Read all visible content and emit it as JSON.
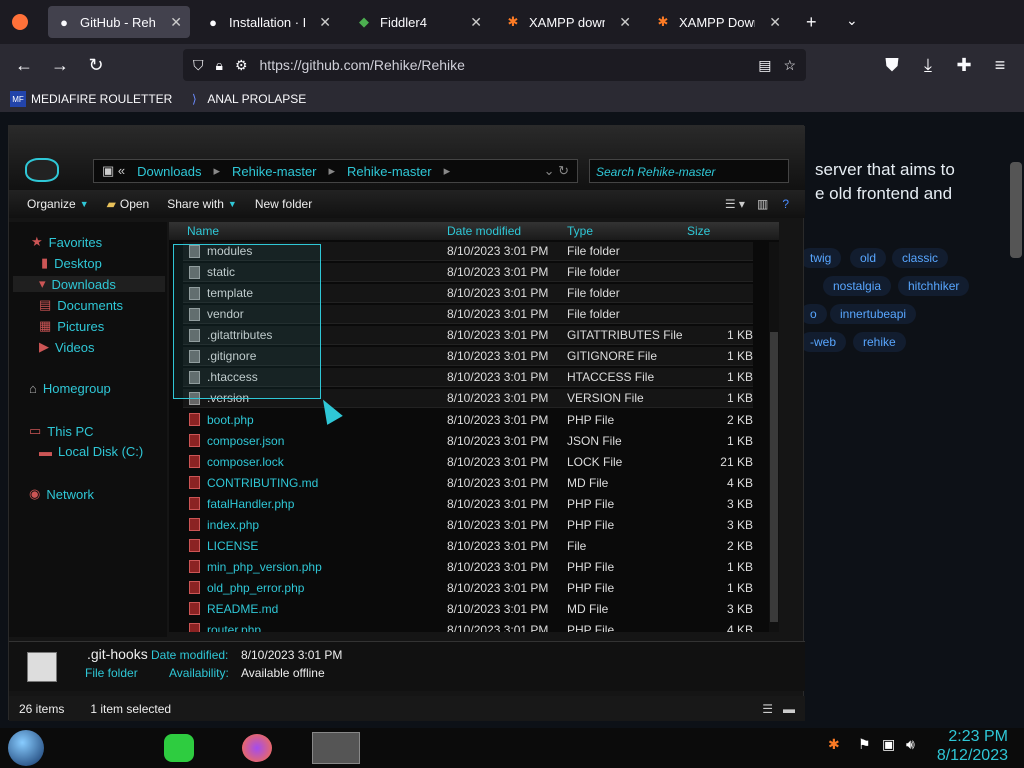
{
  "browser": {
    "tabs": [
      {
        "title": "GitHub - Rehike/R",
        "icon": "github-icon",
        "active": true
      },
      {
        "title": "Installation · Rehi",
        "icon": "github-icon",
        "active": false
      },
      {
        "title": "Fiddler4",
        "icon": "fiddler-icon",
        "active": false
      },
      {
        "title": "XAMPP downloa",
        "icon": "xampp-icon",
        "active": false
      },
      {
        "title": "XAMPP Downloa",
        "icon": "xampp-icon",
        "active": false
      }
    ],
    "url": "https://github.com/Rehike/Rehike",
    "bookmarks": [
      {
        "label": "MEDIAFIRE ROULETTER",
        "icon": "mediafire-icon"
      },
      {
        "label": "ANAL PROLAPSE",
        "icon": "bookmark-icon"
      }
    ]
  },
  "github_page": {
    "desc_line1": "server that aims to",
    "desc_line2": "e old frontend and",
    "topics": [
      "twig",
      "old",
      "classic",
      "nostalgia",
      "hitchhiker",
      "o",
      "innertubeapi",
      "-web",
      "rehike"
    ]
  },
  "explorer": {
    "breadcrumb": [
      "Downloads",
      "Rehike-master",
      "Rehike-master"
    ],
    "search_placeholder": "Search Rehike-master",
    "toolbar": {
      "organize": "Organize",
      "open": "Open",
      "share": "Share with",
      "new_folder": "New folder"
    },
    "nav": {
      "favorites": "Favorites",
      "desktop": "Desktop",
      "downloads": "Downloads",
      "documents": "Documents",
      "pictures": "Pictures",
      "videos": "Videos",
      "homegroup": "Homegroup",
      "this_pc": "This PC",
      "local_disk": "Local Disk (C:)",
      "network": "Network"
    },
    "columns": {
      "name": "Name",
      "date": "Date modified",
      "type": "Type",
      "size": "Size"
    },
    "files": [
      {
        "name": "modules",
        "date": "8/10/2023 3:01 PM",
        "type": "File folder",
        "size": "",
        "selected": true
      },
      {
        "name": "static",
        "date": "8/10/2023 3:01 PM",
        "type": "File folder",
        "size": "",
        "selected": true
      },
      {
        "name": "template",
        "date": "8/10/2023 3:01 PM",
        "type": "File folder",
        "size": "",
        "selected": true
      },
      {
        "name": "vendor",
        "date": "8/10/2023 3:01 PM",
        "type": "File folder",
        "size": "",
        "selected": true
      },
      {
        "name": ".gitattributes",
        "date": "8/10/2023 3:01 PM",
        "type": "GITATTRIBUTES File",
        "size": "1 KB",
        "selected": true
      },
      {
        "name": ".gitignore",
        "date": "8/10/2023 3:01 PM",
        "type": "GITIGNORE File",
        "size": "1 KB",
        "selected": true
      },
      {
        "name": ".htaccess",
        "date": "8/10/2023 3:01 PM",
        "type": "HTACCESS File",
        "size": "1 KB",
        "selected": true
      },
      {
        "name": ".version",
        "date": "8/10/2023 3:01 PM",
        "type": "VERSION File",
        "size": "1 KB",
        "selected": true
      },
      {
        "name": "boot.php",
        "date": "8/10/2023 3:01 PM",
        "type": "PHP File",
        "size": "2 KB",
        "selected": false
      },
      {
        "name": "composer.json",
        "date": "8/10/2023 3:01 PM",
        "type": "JSON File",
        "size": "1 KB",
        "selected": false
      },
      {
        "name": "composer.lock",
        "date": "8/10/2023 3:01 PM",
        "type": "LOCK File",
        "size": "21 KB",
        "selected": false
      },
      {
        "name": "CONTRIBUTING.md",
        "date": "8/10/2023 3:01 PM",
        "type": "MD File",
        "size": "4 KB",
        "selected": false
      },
      {
        "name": "fatalHandler.php",
        "date": "8/10/2023 3:01 PM",
        "type": "PHP File",
        "size": "3 KB",
        "selected": false
      },
      {
        "name": "index.php",
        "date": "8/10/2023 3:01 PM",
        "type": "PHP File",
        "size": "3 KB",
        "selected": false
      },
      {
        "name": "LICENSE",
        "date": "8/10/2023 3:01 PM",
        "type": "File",
        "size": "2 KB",
        "selected": false
      },
      {
        "name": "min_php_version.php",
        "date": "8/10/2023 3:01 PM",
        "type": "PHP File",
        "size": "1 KB",
        "selected": false
      },
      {
        "name": "old_php_error.php",
        "date": "8/10/2023 3:01 PM",
        "type": "PHP File",
        "size": "1 KB",
        "selected": false
      },
      {
        "name": "README.md",
        "date": "8/10/2023 3:01 PM",
        "type": "MD File",
        "size": "3 KB",
        "selected": false
      },
      {
        "name": "router.php",
        "date": "8/10/2023 3:01 PM",
        "type": "PHP File",
        "size": "4 KB",
        "selected": false
      }
    ],
    "details": {
      "name": ".git-hooks",
      "kind": "File folder",
      "date_label": "Date modified:",
      "date_value": "8/10/2023 3:01 PM",
      "avail_label": "Availability:",
      "avail_value": "Available offline"
    },
    "status": {
      "count": "26 items",
      "selected": "1 item selected"
    }
  },
  "taskbar": {
    "time": "2:23 PM",
    "date": "8/12/2023"
  },
  "colors": {
    "accent": "#2fc7d6",
    "browser_bg": "#1c1b22",
    "github_bg": "#0d1117"
  }
}
